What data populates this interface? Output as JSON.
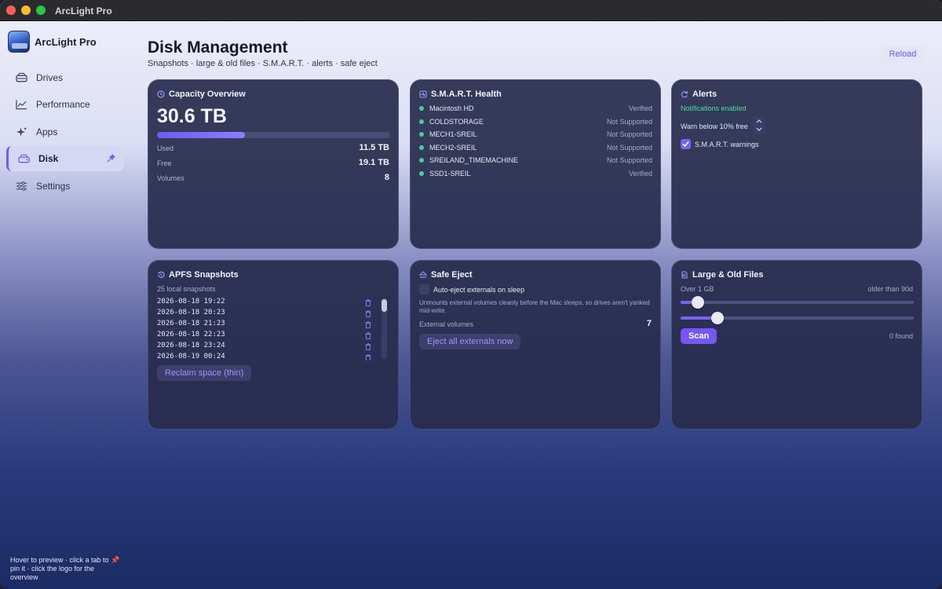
{
  "window": {
    "title": "ArcLight Pro"
  },
  "sidebar": {
    "brand": "ArcLight Pro",
    "items": [
      {
        "label": "Drives",
        "icon": "drive-icon",
        "active": false
      },
      {
        "label": "Performance",
        "icon": "chart-icon",
        "active": false
      },
      {
        "label": "Apps",
        "icon": "sparkle-icon",
        "active": false
      },
      {
        "label": "Disk",
        "icon": "disk-icon",
        "active": true,
        "pinned": true
      },
      {
        "label": "Settings",
        "icon": "sliders-icon",
        "active": false
      }
    ],
    "hint": "Hover to preview · click a tab to 📌 pin it · click the logo for the overview"
  },
  "header": {
    "title": "Disk Management",
    "subtitle": "Snapshots · large & old files · S.M.A.R.T. · alerts · safe eject",
    "reload_label": "Reload"
  },
  "capacity": {
    "title": "Capacity Overview",
    "total": "30.6 TB",
    "used_fraction": 0.376,
    "used_label": "Used",
    "used_value": "11.5 TB",
    "free_label": "Free",
    "free_value": "19.1 TB",
    "volumes_label": "Volumes",
    "volumes_value": "8"
  },
  "smart": {
    "title": "S.M.A.R.T. Health",
    "rows": [
      {
        "name": "Macintosh HD",
        "status": "Verified"
      },
      {
        "name": "COLDSTORAGE",
        "status": "Not Supported"
      },
      {
        "name": "MECH1-SREIL",
        "status": "Not Supported"
      },
      {
        "name": "MECH2-SREIL",
        "status": "Not Supported"
      },
      {
        "name": "SREILAND_TIMEMACHINE",
        "status": "Not Supported"
      },
      {
        "name": "SSD1-SREIL",
        "status": "Verified"
      }
    ],
    "status_color": "#3ed39a"
  },
  "alerts": {
    "title": "Alerts",
    "notifications": "Notifications enabled",
    "warn_label": "Warn below 10% free",
    "smart_warnings_label": "S.M.A.R.T. warnings",
    "smart_warnings_checked": true
  },
  "snapshots": {
    "title": "APFS Snapshots",
    "count_label": "25 local snapshots",
    "rows": [
      "2026-08-18  19:22",
      "2026-08-18  20:23",
      "2026-08-18  21:23",
      "2026-08-18  22:23",
      "2026-08-18  23:24",
      "2026-08-19  00:24"
    ],
    "reclaim_label": "Reclaim space (thin)"
  },
  "eject": {
    "title": "Safe Eject",
    "auto_label": "Auto-eject externals on sleep",
    "auto_checked": false,
    "description": "Unmounts external volumes cleanly before the Mac sleeps, so drives aren't yanked mid-write.",
    "external_label": "External volumes",
    "external_value": "7",
    "eject_all_label": "Eject all externals now"
  },
  "large_files": {
    "title": "Large & Old Files",
    "size_label": "Over 1 GB",
    "age_label": "older than 90d",
    "size_slider_fraction": 0.05,
    "age_slider_fraction": 0.14,
    "scan_label": "Scan",
    "found_label": "0 found"
  },
  "colors": {
    "accent": "#7358f2",
    "success": "#3ed39a"
  }
}
